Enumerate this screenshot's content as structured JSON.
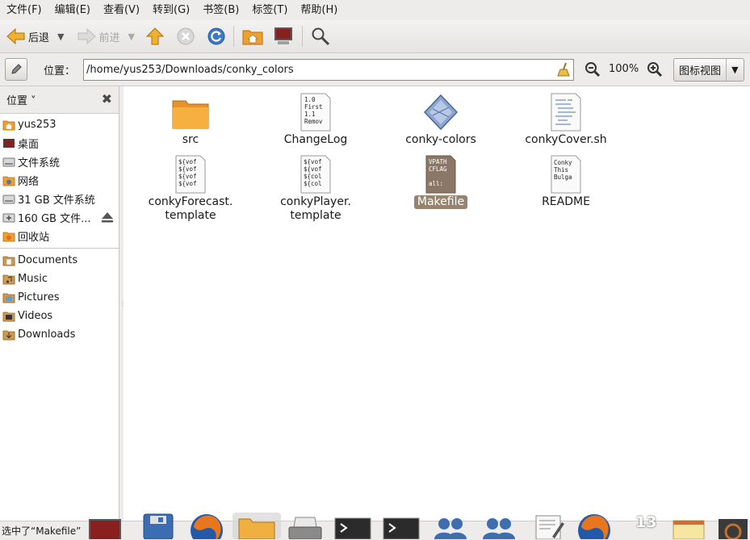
{
  "menu": [
    {
      "label": "文件(F)"
    },
    {
      "label": "编辑(E)"
    },
    {
      "label": "查看(V)"
    },
    {
      "label": "转到(G)"
    },
    {
      "label": "书签(B)"
    },
    {
      "label": "标签(T)"
    },
    {
      "label": "帮助(H)"
    }
  ],
  "toolbar": {
    "back_label": "后退",
    "forward_label": "前进"
  },
  "location": {
    "label": "位置：",
    "path": "/home/yus253/Downloads/conky_colors",
    "zoom": "100%",
    "view_mode": "图标视图"
  },
  "sidebar": {
    "title": "位置",
    "places": [
      {
        "label": "yus253",
        "icon": "home-folder-icon"
      },
      {
        "label": "桌面",
        "icon": "desktop-icon"
      },
      {
        "label": "文件系统",
        "icon": "harddisk-icon"
      },
      {
        "label": "网络",
        "icon": "network-icon"
      },
      {
        "label": "31 GB 文件系统",
        "icon": "harddisk-icon"
      },
      {
        "label": "160 GB 文件...",
        "icon": "usb-drive-icon"
      },
      {
        "label": "回收站",
        "icon": "trash-icon"
      }
    ],
    "bookmarks": [
      {
        "label": "Documents",
        "icon": "folder-documents-icon"
      },
      {
        "label": "Music",
        "icon": "folder-music-icon"
      },
      {
        "label": "Pictures",
        "icon": "folder-pictures-icon"
      },
      {
        "label": "Videos",
        "icon": "folder-videos-icon"
      },
      {
        "label": "Downloads",
        "icon": "folder-downloads-icon"
      }
    ]
  },
  "files": [
    {
      "name": "src",
      "type": "folder",
      "selected": false
    },
    {
      "name": "ChangeLog",
      "type": "text",
      "preview": [
        "1.0",
        "First",
        "1.1",
        "Remov"
      ],
      "selected": false
    },
    {
      "name": "conky-colors",
      "type": "executable",
      "selected": false
    },
    {
      "name": "conkyCover.sh",
      "type": "script",
      "selected": false
    },
    {
      "name": "conkyForecast.\ntemplate",
      "type": "text",
      "preview": [
        "${vof",
        "${vof",
        "${vof",
        "${vof"
      ],
      "selected": false
    },
    {
      "name": "conkyPlayer.\ntemplate",
      "type": "text",
      "preview": [
        "${vof",
        "${vof",
        "${col",
        "${col"
      ],
      "selected": false
    },
    {
      "name": "Makefile",
      "type": "makefile",
      "preview": [
        "VPATH",
        "CFLAG",
        "",
        "all:"
      ],
      "selected": true
    },
    {
      "name": "README",
      "type": "text",
      "preview": [
        "Conky",
        "This",
        "Bulga"
      ],
      "selected": false
    }
  ],
  "status": {
    "text": "选中了“Makefile”"
  },
  "taskbar": {
    "clock": "13"
  },
  "colors": {
    "selection": "#968370",
    "accent_orange": "#f0a030"
  }
}
